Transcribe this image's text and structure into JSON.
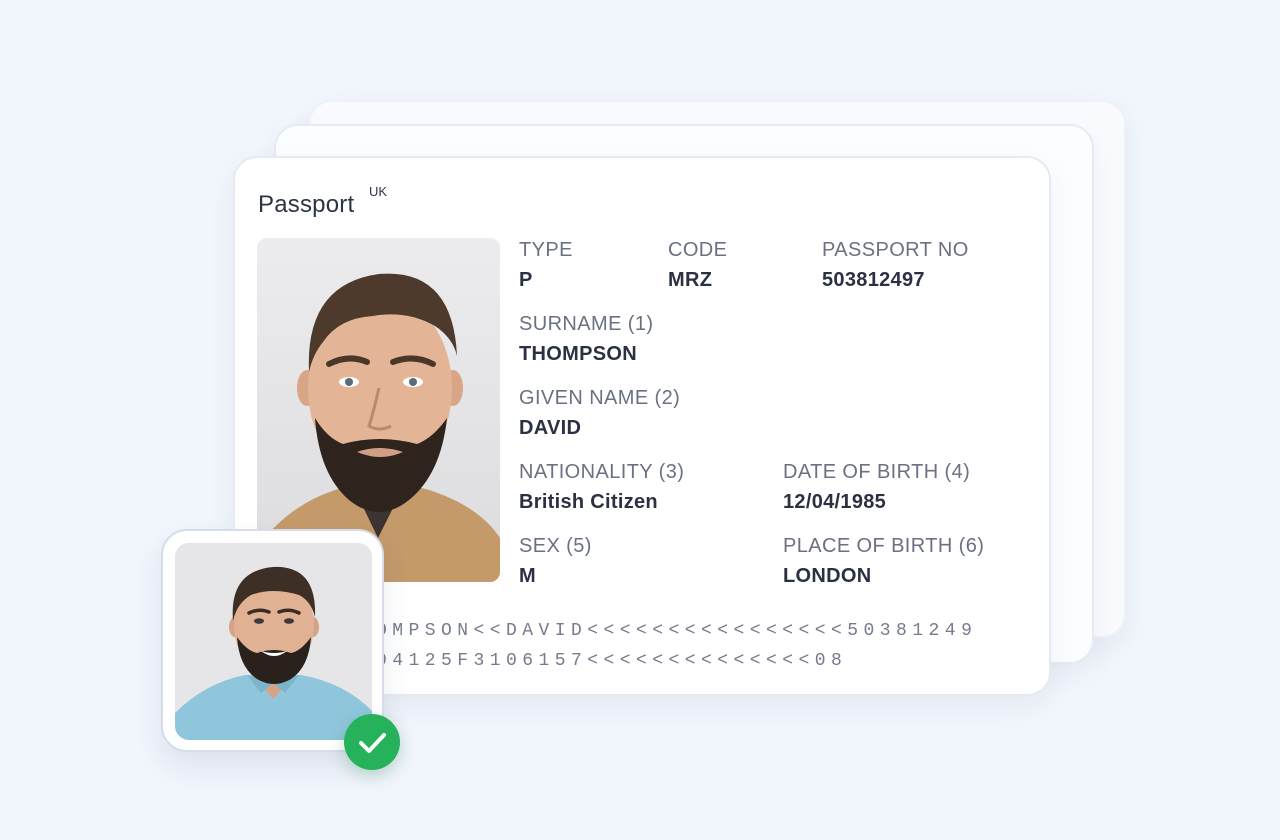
{
  "passport": {
    "title": "Passport",
    "country": "UK",
    "fields": {
      "type": {
        "label": "TYPE",
        "value": "P"
      },
      "code": {
        "label": "CODE",
        "value": "MRZ"
      },
      "passport_no": {
        "label": "PASSPORT NO",
        "value": "503812497"
      },
      "surname": {
        "label": "SURNAME (1)",
        "value": "THOMPSON"
      },
      "given_name": {
        "label": "GIVEN NAME (2)",
        "value": "DAVID"
      },
      "nationality": {
        "label": "NATIONALITY (3)",
        "value": "British Citizen"
      },
      "date_of_birth": {
        "label": "DATE OF BIRTH (4)",
        "value": "12/04/1985"
      },
      "sex": {
        "label": "SEX (5)",
        "value": "M"
      },
      "place_of_birth": {
        "label": "PLACE OF BIRTH (6)",
        "value": "LONDON"
      }
    },
    "mrz": {
      "line1": "OMPSON<<DAVID<<<<<<<<<<<<<<<<50381249",
      "line2": "04125F3106157<<<<<<<<<<<<<<08"
    }
  },
  "verification": {
    "status_icon": "checkmark-icon",
    "status_color": "#26b25b"
  }
}
